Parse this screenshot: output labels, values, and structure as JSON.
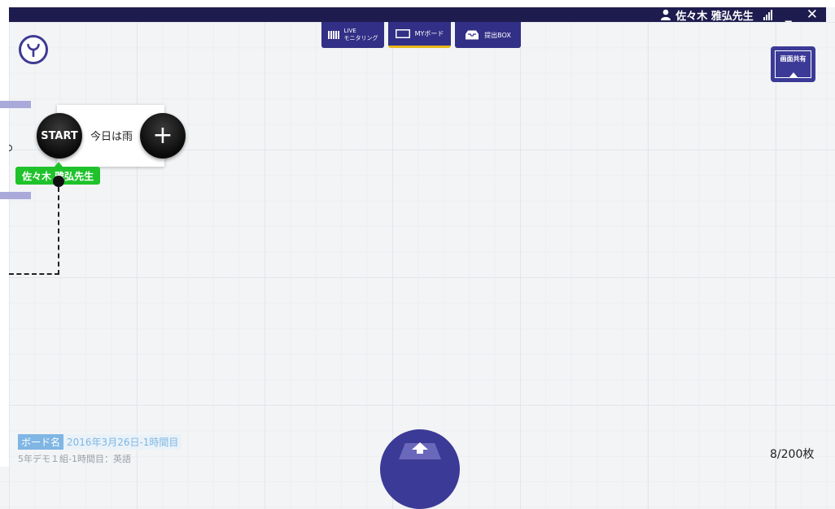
{
  "header": {
    "user_name": "佐々木 雅弘先生",
    "icons": [
      "user-icon",
      "signal-icon",
      "minimize-icon",
      "close-icon"
    ],
    "minimize_label": "_",
    "close_label": "✕"
  },
  "tabs": [
    {
      "line1": "LIVE",
      "line2": "モニタリング",
      "icon": "grid-icon"
    },
    {
      "label": "MYボード",
      "icon": "board-icon",
      "active": true
    },
    {
      "label": "提出BOX",
      "icon": "tray-icon"
    }
  ],
  "share_button": {
    "label": "画面共有"
  },
  "card": {
    "start_label": "START",
    "text": "今日は雨",
    "plus_label": "+",
    "author": "佐々木 雅弘先生"
  },
  "footer": {
    "board_name_key": "ボード名",
    "board_name_value": "2016年3月26日-1時間目",
    "class_info": "5年デモ１組-1時間目：英語",
    "count": "8/200枚"
  },
  "colors": {
    "header": "#1e1c4e",
    "primary": "#3c3a97",
    "tab_active_underline": "#e8b81a",
    "author_tag": "#1fc22b",
    "board_name_key": "#7fb6e4"
  }
}
